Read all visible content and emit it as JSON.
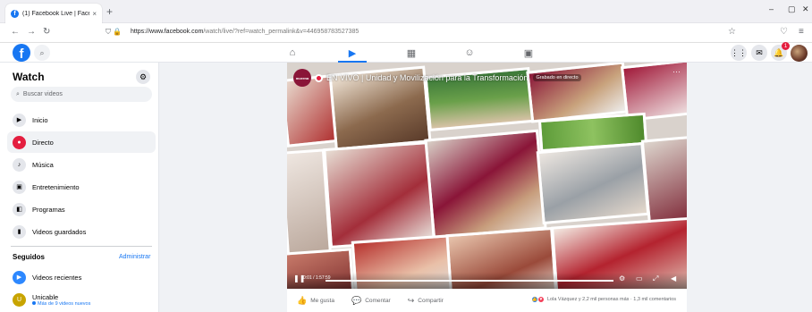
{
  "browser": {
    "tab_title": "(1) Facebook Live | Facebook",
    "tab_close": "×",
    "new_tab": "+",
    "url_domain": "https://www.facebook.com",
    "url_path": "/watch/live/?ref=watch_permalink&v=446958783527385",
    "window_controls": [
      "–",
      "▢",
      "✕"
    ]
  },
  "fb_bar": {
    "logo": "f",
    "nav_icons": [
      "home-icon",
      "watch-icon",
      "marketplace-icon",
      "groups-icon",
      "gaming-icon"
    ],
    "notification_count": "1"
  },
  "sidebar": {
    "title": "Watch",
    "search_placeholder": "Buscar videos",
    "items": [
      {
        "label": "Inicio",
        "icon": "home-icon"
      },
      {
        "label": "Directo",
        "icon": "live-icon"
      },
      {
        "label": "Música",
        "icon": "music-icon"
      },
      {
        "label": "Entretenimiento",
        "icon": "tv-icon"
      },
      {
        "label": "Programas",
        "icon": "shows-icon"
      },
      {
        "label": "Videos guardados",
        "icon": "bookmark-icon"
      }
    ],
    "section_title": "Seguidos",
    "section_action": "Administrar",
    "followed": [
      {
        "label": "Videos recientes",
        "sub": ""
      },
      {
        "label": "Unicable",
        "sub": "Más de 9 videos nuevos"
      }
    ]
  },
  "video": {
    "page_avatar_text": "morena",
    "live_title": "EN VIVO | Unidad y Movilización para la Transformación",
    "live_tag": "Grabado en directo",
    "time": "0:01 / 1:57:59",
    "progress": 1.0
  },
  "actions": {
    "like": "Me gusta",
    "comment": "Comentar",
    "share": "Compartir",
    "reactions_text": "Lola Vázquez y 2,2 mil personas más · 1,3 mil comentarios"
  },
  "colors": {
    "accent": "#1877f2",
    "live_red": "#e41e3f",
    "morena": "#8a1538"
  }
}
